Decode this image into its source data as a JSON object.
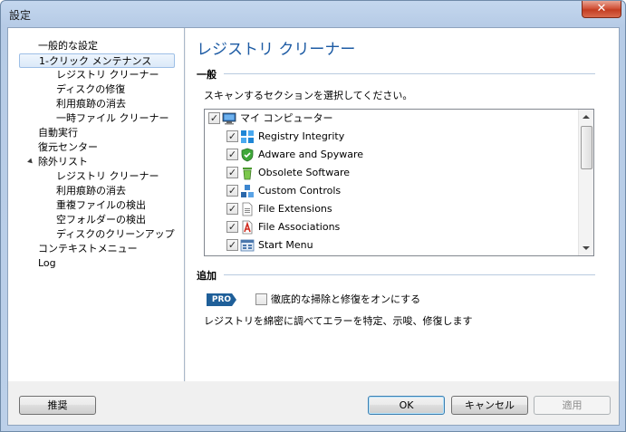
{
  "window": {
    "title": "設定",
    "close_label": "✕"
  },
  "sidebar": {
    "items": [
      {
        "label": "一般的な設定"
      },
      {
        "label": "1-クリック メンテナンス"
      },
      {
        "label": "レジストリ クリーナー"
      },
      {
        "label": "ディスクの修復"
      },
      {
        "label": "利用痕跡の消去"
      },
      {
        "label": "一時ファイル クリーナー"
      },
      {
        "label": "自動実行"
      },
      {
        "label": "復元センター"
      },
      {
        "label": "除外リスト"
      },
      {
        "label": "レジストリ クリーナー"
      },
      {
        "label": "利用痕跡の消去"
      },
      {
        "label": "重複ファイルの検出"
      },
      {
        "label": "空フォルダーの検出"
      },
      {
        "label": "ディスクのクリーンアップ"
      },
      {
        "label": "コンテキストメニュー"
      },
      {
        "label": "Log"
      }
    ],
    "selected_index": 1
  },
  "main": {
    "title": "レジストリ クリーナー",
    "general": {
      "header": "一般",
      "description": "スキャンするセクションを選択してください。",
      "tree_root": {
        "label": "マイ コンピューター",
        "checked": true,
        "icon": "computer-icon"
      },
      "tree_items": [
        {
          "label": "Registry Integrity",
          "checked": true,
          "icon": "registry-integrity-icon"
        },
        {
          "label": "Adware and Spyware",
          "checked": true,
          "icon": "shield-icon"
        },
        {
          "label": "Obsolete Software",
          "checked": true,
          "icon": "trash-icon"
        },
        {
          "label": "Custom Controls",
          "checked": true,
          "icon": "controls-icon"
        },
        {
          "label": "File Extensions",
          "checked": true,
          "icon": "file-extension-icon"
        },
        {
          "label": "File Associations",
          "checked": true,
          "icon": "file-association-icon"
        },
        {
          "label": "Start Menu",
          "checked": true,
          "icon": "start-menu-icon"
        }
      ]
    },
    "extra": {
      "header": "追加",
      "pro_badge": "PRO",
      "deep_scan_label": "徹底的な掃除と修復をオンにする",
      "deep_scan_checked": false,
      "deep_scan_description": "レジストリを綿密に調べてエラーを特定、示唆、修復します"
    }
  },
  "footer": {
    "recommend_label": "推奨",
    "ok_label": "OK",
    "cancel_label": "キャンセル",
    "apply_label": "適用"
  },
  "colors": {
    "accent": "#1d5ba4",
    "pro": "#1f5f99",
    "selection": "#dbe9f8"
  }
}
